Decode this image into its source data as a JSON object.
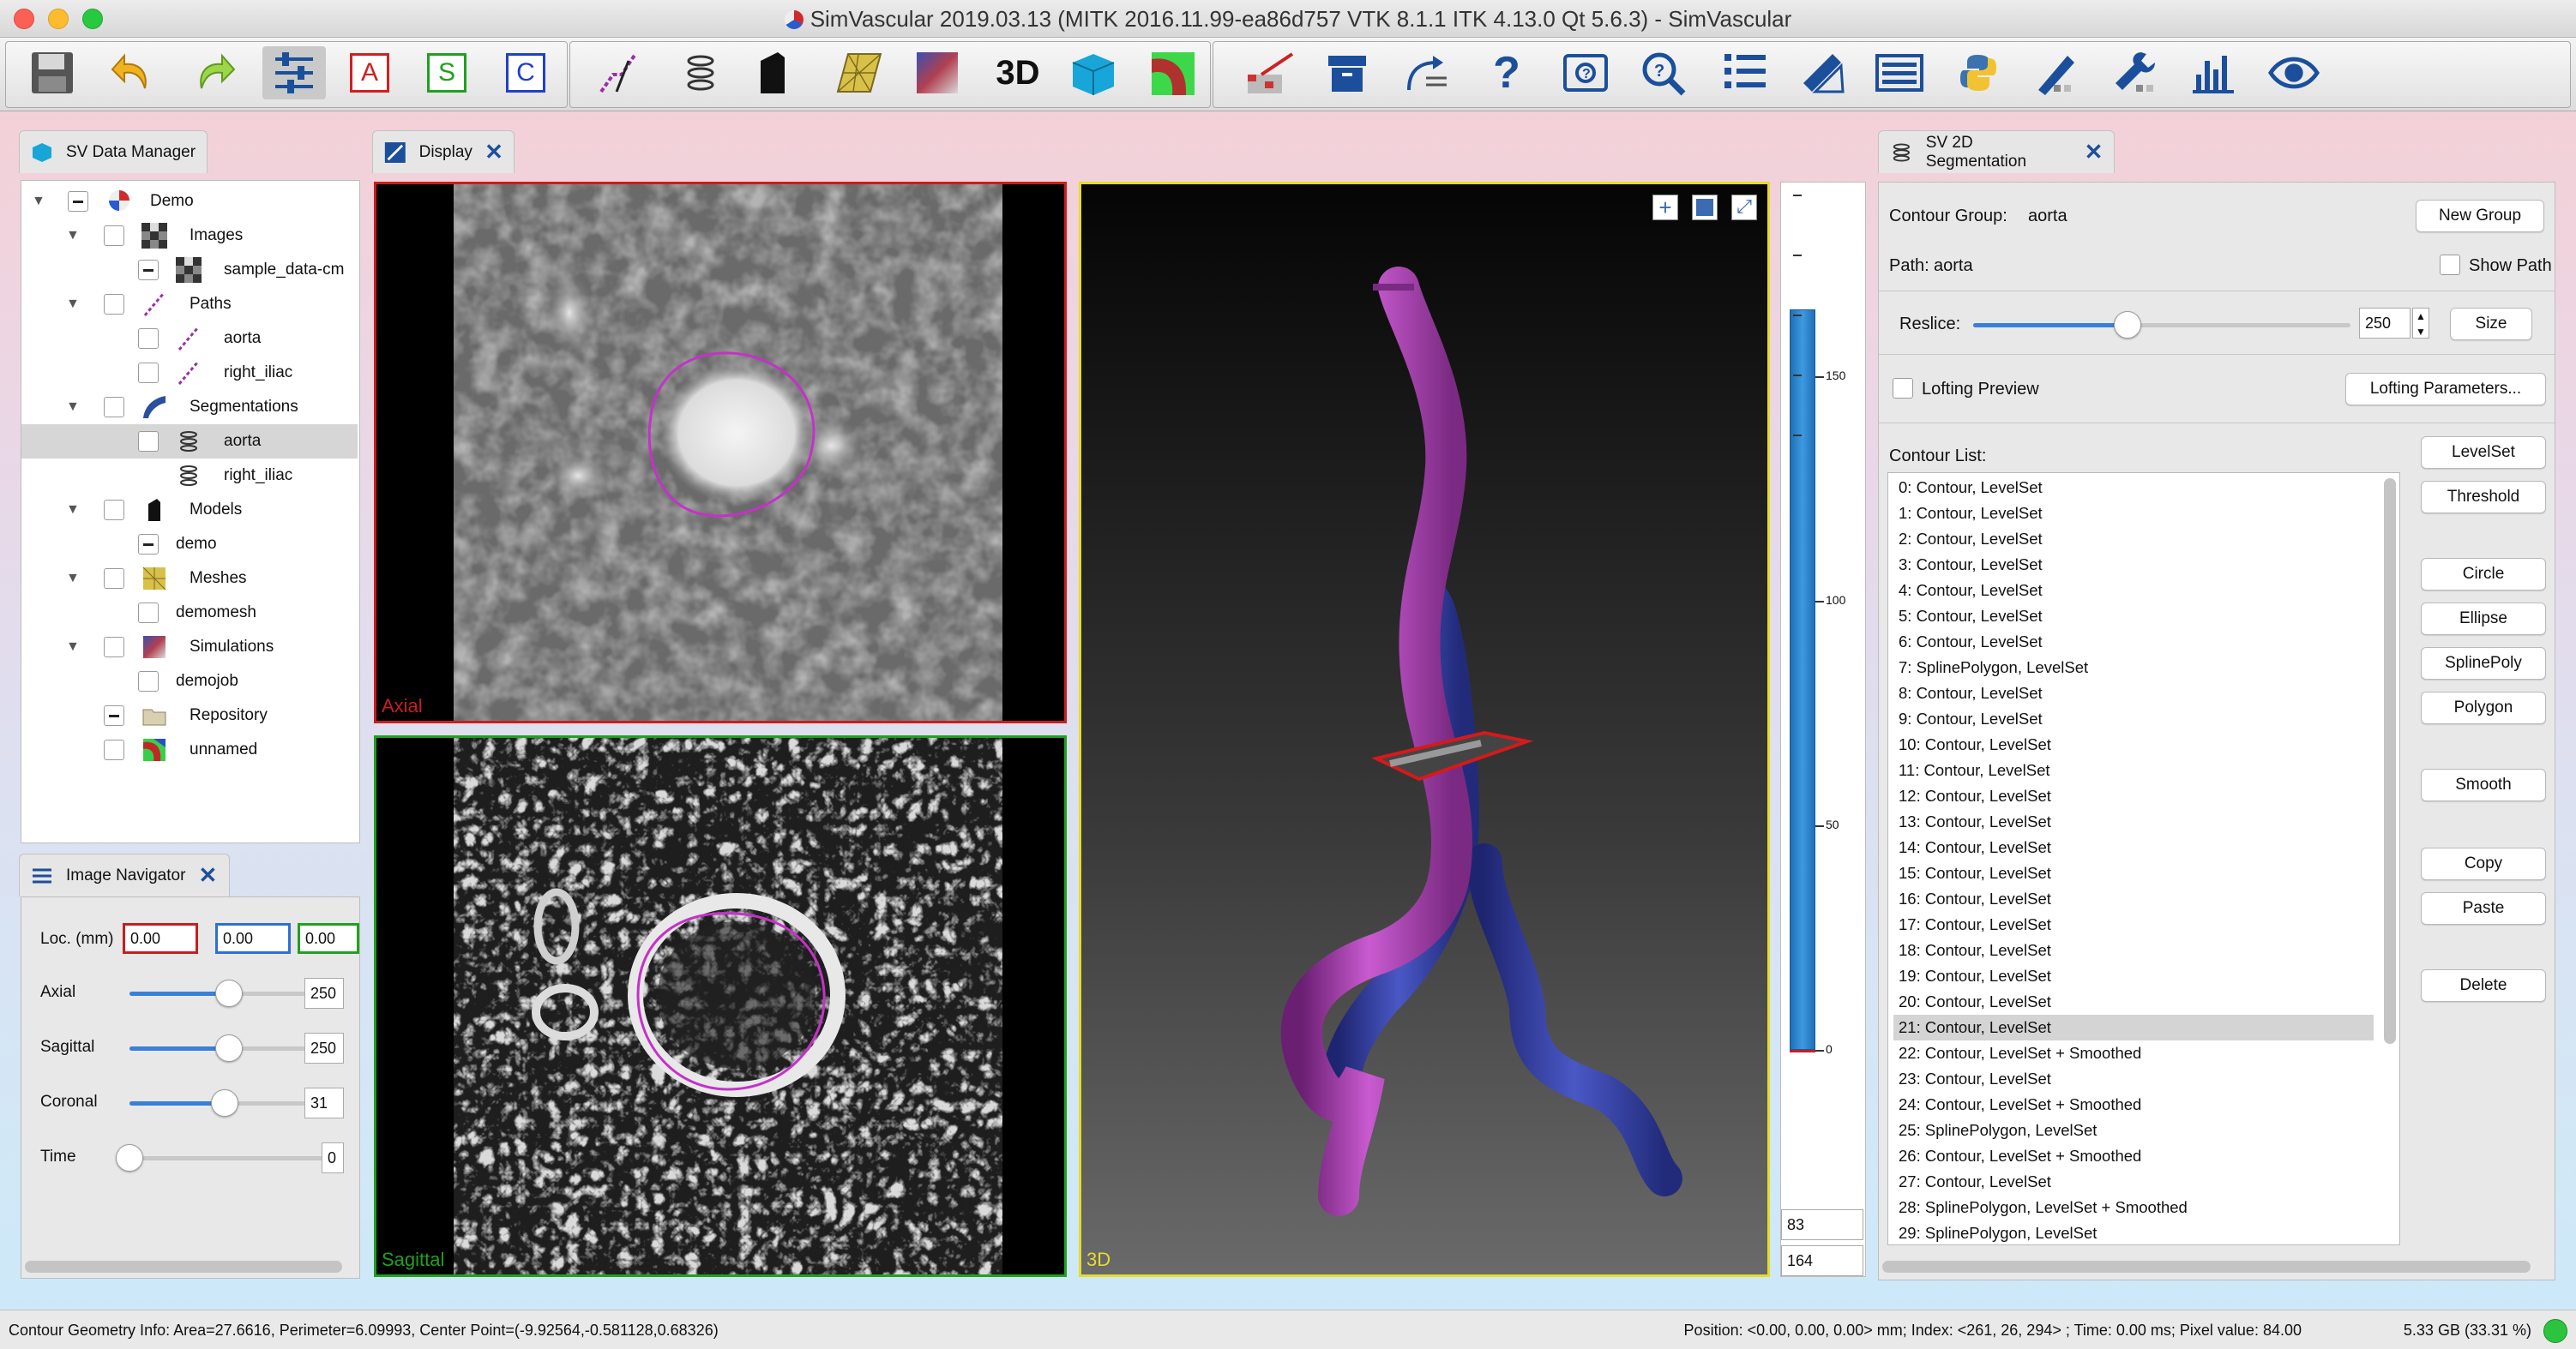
{
  "window": {
    "title": "SimVascular 2019.03.13 (MITK 2016.11.99-ea86d757 VTK 8.1.1 ITK 4.13.0 Qt 5.6.3) - SimVascular"
  },
  "toolbar": {
    "items": [
      "save-icon",
      "undo-icon",
      "redo-icon",
      "sliders-icon",
      "A",
      "S",
      "C",
      "path-planning-icon",
      "segmentation-icon",
      "model-icon",
      "mesh-icon",
      "simulation-icon",
      "3d-icon",
      "cube-icon",
      "tube-color-icon",
      "image-edit-icon",
      "archive-box-icon",
      "convert-arrows-icon",
      "help-icon",
      "toolbox-icon",
      "search-icon",
      "log-icon",
      "measure-icon",
      "list-icon",
      "python-icon",
      "brush-icon",
      "wrench-icon",
      "bar-chart-icon",
      "eye-icon"
    ],
    "letter_a": "A",
    "letter_s": "S",
    "letter_c": "C"
  },
  "data_manager": {
    "tab_label": "SV Data Manager",
    "tree": [
      {
        "label": "Demo"
      },
      {
        "label": "Images"
      },
      {
        "label": "sample_data-cm"
      },
      {
        "label": "Paths"
      },
      {
        "label": "aorta"
      },
      {
        "label": "right_iliac"
      },
      {
        "label": "Segmentations"
      },
      {
        "label": "aorta"
      },
      {
        "label": "right_iliac"
      },
      {
        "label": "Models"
      },
      {
        "label": "demo"
      },
      {
        "label": "Meshes"
      },
      {
        "label": "demomesh"
      },
      {
        "label": "Simulations"
      },
      {
        "label": "demojob"
      },
      {
        "label": "Repository"
      },
      {
        "label": "unnamed"
      }
    ]
  },
  "display": {
    "tab_label": "Display",
    "axial_label": "Axial",
    "sagittal_label": "Sagittal",
    "view3d_label": "3D",
    "ruler_ticks": [
      "150",
      "100",
      "50",
      "0"
    ],
    "value_top": "83",
    "value_bottom": "164"
  },
  "image_navigator": {
    "tab_label": "Image Navigator",
    "loc_label": "Loc. (mm)",
    "loc_x": "0.00",
    "loc_y": "0.00",
    "loc_z": "0.00",
    "axial_label": "Axial",
    "axial_value": "250",
    "axial_fraction": 0.5,
    "sagittal_label": "Sagittal",
    "sagittal_value": "250",
    "sagittal_fraction": 0.5,
    "coronal_label": "Coronal",
    "coronal_value": "31",
    "coronal_fraction": 0.48,
    "time_label": "Time",
    "time_value": "0",
    "time_fraction": 0.0
  },
  "segmentation": {
    "tab_label": "SV 2D Segmentation",
    "contour_group_label": "Contour Group:",
    "contour_group_value": "aorta",
    "new_group_button": "New Group",
    "path_label": "Path:",
    "path_value": "aorta",
    "show_path_label": "Show Path",
    "reslice_label": "Reslice:",
    "reslice_value": "250",
    "reslice_fraction": 0.41,
    "size_button": "Size",
    "lofting_preview_label": "Lofting Preview",
    "lofting_params_button": "Lofting Parameters...",
    "contour_list_label": "Contour List:",
    "selected_index": 21,
    "contours": [
      "0: Contour, LevelSet",
      "1: Contour, LevelSet",
      "2: Contour, LevelSet",
      "3: Contour, LevelSet",
      "4: Contour, LevelSet",
      "5: Contour, LevelSet",
      "6: Contour, LevelSet",
      "7: SplinePolygon, LevelSet",
      "8: Contour, LevelSet",
      "9: Contour, LevelSet",
      "10: Contour, LevelSet",
      "11: Contour, LevelSet",
      "12: Contour, LevelSet",
      "13: Contour, LevelSet",
      "14: Contour, LevelSet",
      "15: Contour, LevelSet",
      "16: Contour, LevelSet",
      "17: Contour, LevelSet",
      "18: Contour, LevelSet",
      "19: Contour, LevelSet",
      "20: Contour, LevelSet",
      "21: Contour, LevelSet",
      "22: Contour, LevelSet + Smoothed",
      "23: Contour, LevelSet",
      "24: Contour, LevelSet + Smoothed",
      "25: SplinePolygon, LevelSet",
      "26: Contour, LevelSet + Smoothed",
      "27: Contour, LevelSet",
      "28: SplinePolygon, LevelSet + Smoothed",
      "29: SplinePolygon, LevelSet"
    ],
    "buttons": {
      "levelset": "LevelSet",
      "threshold": "Threshold",
      "circle": "Circle",
      "ellipse": "Ellipse",
      "splinepoly": "SplinePoly",
      "polygon": "Polygon",
      "smooth": "Smooth",
      "copy": "Copy",
      "paste": "Paste",
      "delete": "Delete"
    }
  },
  "status": {
    "left": "Contour Geometry Info: Area=27.6616, Perimeter=6.09993, Center Point=(-9.92564,-0.581128,0.68326)",
    "right": "Position: <0.00, 0.00, 0.00> mm; Index: <261, 26, 294> ; Time: 0.00 ms; Pixel value: 84.00",
    "memory": "5.33 GB (33.31 %)"
  },
  "colors": {
    "axial_border": "#c81e1e",
    "sagittal_border": "#1fa11f",
    "view3d_border": "#e6dc2a",
    "aorta": "#a23ea8",
    "iliac": "#3642a8",
    "accent": "#3a7fd8"
  }
}
